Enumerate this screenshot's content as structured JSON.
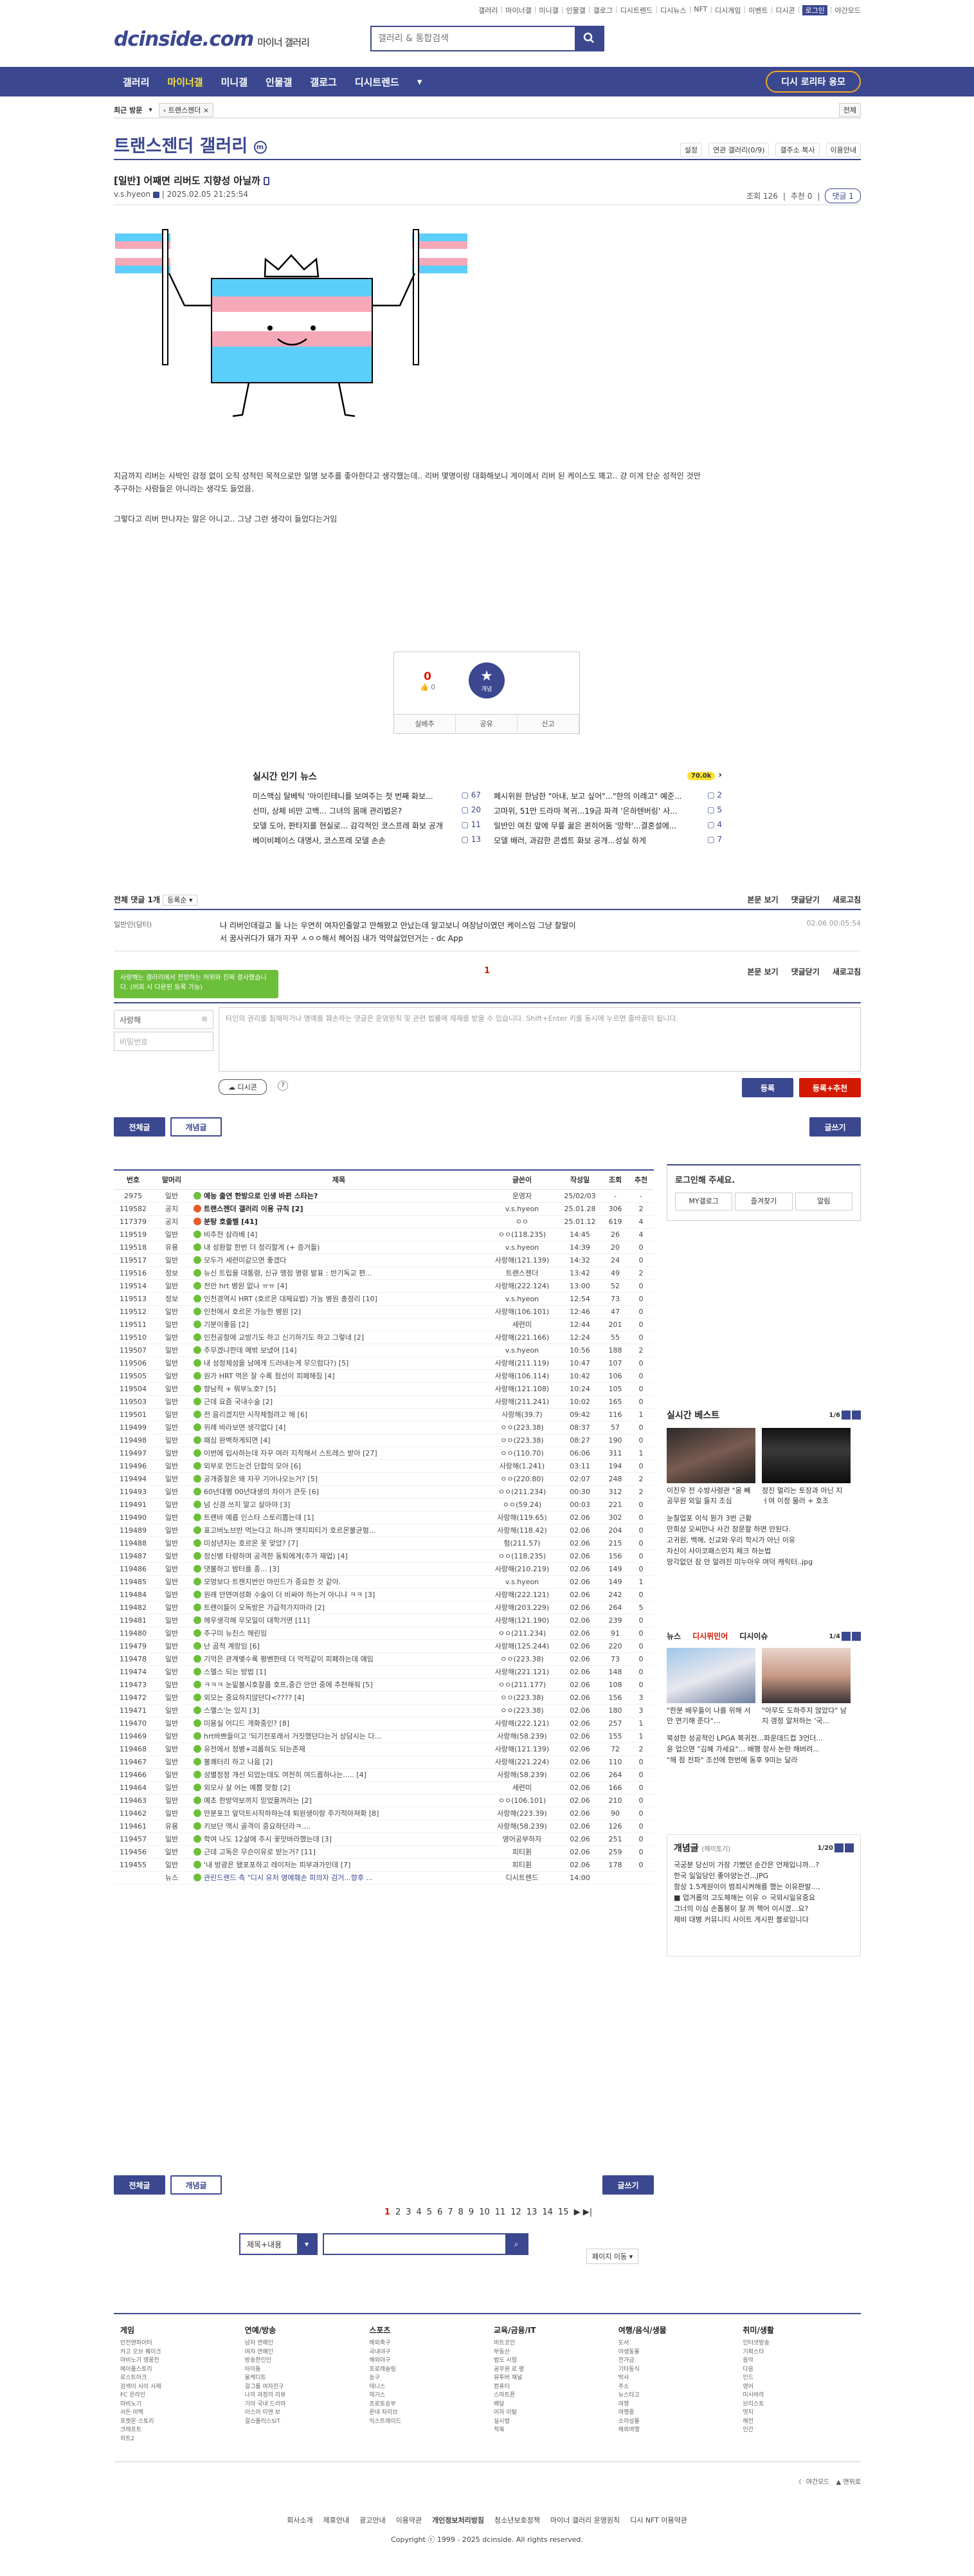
{
  "top_links": [
    "갤러리",
    "마이너갤",
    "미니갤",
    "인물갤",
    "갤로그",
    "디시트렌드",
    "디시뉴스",
    "NFT",
    "디시게임",
    "이벤트",
    "디시콘",
    "로그인",
    "야간모드"
  ],
  "brand": {
    "logo": "dcinside.com",
    "sub": "마이너 갤러리"
  },
  "search": {
    "placeholder": "갤러리 & 통합검색"
  },
  "nav": {
    "items": [
      "갤러리",
      "마이너갤",
      "미니갤",
      "인물갤",
      "갤로그",
      "디시트렌드"
    ],
    "promo": "디시 로리타 응모"
  },
  "crumb": {
    "recent": "최근 방문",
    "gallery": "트랜스젠더",
    "all": "전체"
  },
  "gallery": {
    "title": "트랜스젠더 갤러리",
    "tools": [
      "설정",
      "연관 갤러리(0/9)",
      "갤주소 복사",
      "이용안내"
    ]
  },
  "post": {
    "title": "[일반] 어째면 리버도 지향성 아닐까",
    "author": "v.s.hyeon",
    "date": "2025.02.05 21:25:54",
    "views": "조회 126",
    "recs": "추천 0",
    "comments": "댓글 1",
    "body1": "지금까지 리버는 사박인 감정 없이 오직 성적인 목적으로만 일명 보추를 좋아한다고 생각했는데.. 리버 몇명이랑 대화해보니 게이에서 리버 된 케이스도 꽤고.. 걍 이게 단순 성적인 것만 추구하는 사람들은 아니라는 생각도 들었음.",
    "body2": "그렇다고 리버 만나자는 말은 아니고.. 그냥 그런 생각이 들었다는거임"
  },
  "rec": {
    "up": "0",
    "down": "0",
    "fixed": "개념",
    "actions": [
      "실베추",
      "공유",
      "신고"
    ]
  },
  "news": {
    "title": "실시간 인기 뉴스",
    "badge": "70.0k",
    "items": [
      {
        "t": "미스맥심 탈베틱 '아이린테니를 보여주는 첫 번째 화보...",
        "n": "67"
      },
      {
        "t": "폐시위원 한남한 \"아내, 보고 싶어\"...\"한의 이례고\" 예준...",
        "n": "2"
      },
      {
        "t": "선미, 상체 비만 고백... 그녀의 몸매 관리법은?",
        "n": "20"
      },
      {
        "t": "고마위, 51만 드라마 복귀...19금 파격 '은하텐버링' 사...",
        "n": "5"
      },
      {
        "t": "모델 도아, 판타지를 현실로... 감각적인 코스프레 화보 공개",
        "n": "11"
      },
      {
        "t": "일반인 여친 앞에 무릎 꿇은 퀸히어둠 '망학'...결혼설에...",
        "n": "4"
      },
      {
        "t": "베이비페이스 대명사, 코스프레 모델 손손",
        "n": "13"
      },
      {
        "t": "모델 배러, 과감한 콘셉트 화보 공개...성실 하게",
        "n": "7"
      }
    ]
  },
  "comments": {
    "total": "전체 댓글 1개",
    "sort": "등록순",
    "view": "본문 보기",
    "fold": "댓글닫기",
    "refresh": "새로고침",
    "item": {
      "nick": "일반인(담터)",
      "text": "나 리버인데걸고 둘 나는 우연히 여자인줄알고 만해왔고 만났는데 알고보니 여장남이였던 케이스임 그냥 찰말이서 꿈사귀다가 돼가 자꾸 ㅅㅇㅇ해서 헤어짐 내가 먹약싫었던거는 - dc App",
      "date": "02.06 00:05:54"
    },
    "page": "1",
    "tip": "사랑해는 갤러리에서 전방하는 허위와 진짜 결사했습니다. (비회 시 다운된 등록 가능)",
    "nick_ph": "사랑해",
    "pw_ph": "비밀번호",
    "ta_ph": "타인의 권리를 침해하거나 명예를 훼손하는 댓글은 운영원칙 및 관련 법률에 제재를 받을 수 있습니다. Shift+Enter 키를 동시에 누르면 줄바꿈이 됩니다.",
    "dccon": "디시콘",
    "submit": "등록",
    "submit_rec": "등록+추천"
  },
  "listtabs": {
    "all": "전체글",
    "best": "개념글",
    "write": "글쓰기"
  },
  "table": {
    "headers": [
      "번호",
      "말머리",
      "제목",
      "글쓴이",
      "작성일",
      "조회",
      "추천"
    ],
    "rows": [
      [
        "2975",
        "일반",
        "예능 출연 한방으로 인생 바뀐 스타는?",
        "운영자",
        "25/02/03",
        "-",
        "-"
      ],
      [
        "119582",
        "공지",
        "트랜스젠더 갤러리 이용 규칙 [2]",
        "v.s.hyeon",
        "25.01.28",
        "306",
        "2"
      ],
      [
        "117379",
        "공지",
        "분탕 호출벨 [41]",
        "ㅇㅇ",
        "25.01.12",
        "619",
        "4"
      ],
      [
        "119519",
        "일반",
        "비추천 삼라베 [4]",
        "ㅇㅇ(118.235)",
        "14:45",
        "26",
        "4"
      ],
      [
        "119518",
        "유용",
        "내 성환할 한번 더 정리할게 (+ 증거들)",
        "v.s.hyeon",
        "14:39",
        "20",
        "0"
      ],
      [
        "119517",
        "일반",
        "모두가 세련미같으면 좋겠다",
        "사랑해(121.139)",
        "14:32",
        "24",
        "0"
      ],
      [
        "119516",
        "정보",
        "뉴신 트립을 대통령, 신규 맹점 명령 발표 : 반기독교 편...",
        "트랜스젠더",
        "13:42",
        "49",
        "2"
      ],
      [
        "119514",
        "일반",
        "전안 hrt 병원 없나 ㅠㅠ [4]",
        "사랑해(222.124)",
        "13:00",
        "52",
        "0"
      ],
      [
        "119513",
        "정보",
        "인천경역시 HRT (호르몬 대체요법) 가능 병원 총정리 [10]",
        "v.s.hyeon",
        "12:54",
        "73",
        "0"
      ],
      [
        "119512",
        "일반",
        "인천에서 호르몬 가능한 병원 [2]",
        "사랑해(106.101)",
        "12:46",
        "47",
        "0"
      ],
      [
        "119511",
        "일반",
        "기분이좋음 [2]",
        "세련미",
        "12:44",
        "201",
        "0"
      ],
      [
        "119510",
        "일반",
        "인천공항에 교방기도 하고 신기하기도 하고 그렇네 [2]",
        "사랑해(221.166)",
        "12:24",
        "55",
        "0"
      ],
      [
        "119507",
        "일반",
        "주무겠냐한데 예밖 보냈어 [14]",
        "v.s.hyeon",
        "10:56",
        "188",
        "2"
      ],
      [
        "119506",
        "일반",
        "내 성정체성을 남에게 드러내는게 무으럼다?) [5]",
        "사랑해(211.119)",
        "10:47",
        "107",
        "0"
      ],
      [
        "119505",
        "일반",
        "원가 HRT 먹은 잘 수록 점선이 피페해짐 [4]",
        "사랑해(106.114)",
        "10:42",
        "106",
        "0"
      ],
      [
        "119504",
        "일반",
        "향남적 + 뭐부노호? [5]",
        "사랑해(121.108)",
        "10:24",
        "105",
        "0"
      ],
      [
        "119503",
        "일반",
        "근데 요즘 국내수술 [2]",
        "사랑해(211.241)",
        "10:02",
        "165",
        "0"
      ],
      [
        "119501",
        "일반",
        "전 음리겠지만 시작체험려고 해 [6]",
        "사랑해(39.7)",
        "09:42",
        "116",
        "1"
      ],
      [
        "119499",
        "일반",
        "위례 바라보면 생각없다 [4]",
        "ㅇㅇ(223.38)",
        "08:37",
        "57",
        "0"
      ],
      [
        "119498",
        "일반",
        "패심 완벽하게되면 [4]",
        "ㅇㅇ(223.38)",
        "08:27",
        "190",
        "0"
      ],
      [
        "119497",
        "일반",
        "이번에 입사하는데 자꾸 여러 지적해서 스트레스 받아 [27]",
        "ㅇㅇ(110.70)",
        "06:06",
        "311",
        "1"
      ],
      [
        "119496",
        "일반",
        "외부로 먼드는건 단합의 모아 [6]",
        "사랑해(1.241)",
        "03:11",
        "194",
        "0"
      ],
      [
        "119494",
        "일반",
        "공개중절은 왜 자꾸 기어나오는거? [5]",
        "ㅇㅇ(220.80)",
        "02:07",
        "248",
        "2"
      ],
      [
        "119493",
        "일반",
        "60년대행 00년대생의 차이가 큰듯 [6]",
        "ㅇㅇ(211.234)",
        "00:30",
        "312",
        "2"
      ],
      [
        "119491",
        "일반",
        "넘 신경 쓰지 말고 살아야 [3]",
        "ㅇㅇ(59.24)",
        "00:03",
        "221",
        "0"
      ],
      [
        "119490",
        "일반",
        "트랜바 예릅 인스타 스토리뽑는데 [1]",
        "사랑해(119.65)",
        "02.06",
        "302",
        "0"
      ],
      [
        "119489",
        "일반",
        "표고버노브반 먹는다고 하니까 옛지피티가 호르몬불균형...",
        "사랑해(118.42)",
        "02.06",
        "204",
        "0"
      ],
      [
        "119488",
        "일반",
        "미성년자는 호르몬 못 맞았? [7]",
        "헝(211.57)",
        "02.06",
        "215",
        "0"
      ],
      [
        "119487",
        "일반",
        "정신병 타령하며 공격한 동퇴에게(추가 재업) [4]",
        "ㅇㅇ(118.235)",
        "02.06",
        "156",
        "0"
      ],
      [
        "119486",
        "일반",
        "댓불하고 밤터를 종... [3]",
        "사랑해(210.219)",
        "02.06",
        "149",
        "0"
      ],
      [
        "119485",
        "일반",
        "모멍보다 트젠지번인 마인드가 중요한 것 같아.",
        "v.s.hyeon",
        "02.06",
        "149",
        "1"
      ],
      [
        "119484",
        "일반",
        "원래 안면여성화 수술이 더 비싸야 하는거 아니냐 ㅋㅋ [3]",
        "사랑해(222.121)",
        "02.06",
        "242",
        "0"
      ],
      [
        "119482",
        "일반",
        "트랜이들이 오독방은 가급적가지마라 [2]",
        "사랑해(203.229)",
        "02.06",
        "264",
        "5"
      ],
      [
        "119481",
        "일반",
        "헤우생각해 무모일이 대학거면 [11]",
        "사랑해(121.190)",
        "02.06",
        "239",
        "0"
      ],
      [
        "119480",
        "일반",
        "추구미 뉴진스 해린임",
        "ㅇㅇ(211.234)",
        "02.06",
        "91",
        "0"
      ],
      [
        "119479",
        "일반",
        "난 곰적 계랑임 [6]",
        "사랑해(125.244)",
        "02.06",
        "220",
        "0"
      ],
      [
        "119478",
        "일반",
        "기억은 관계맺수록 평벤한테 더 억적같이 피폐하는데 얘임",
        "ㅇㅇ(223.38)",
        "02.06",
        "73",
        "0"
      ],
      [
        "119474",
        "일반",
        "스멜스 되는 방법 [1]",
        "사랑해(221.121)",
        "02.06",
        "148",
        "0"
      ],
      [
        "119473",
        "일반",
        "ㅋㅋㅋ 눈밑볼시호잘룹 호프,중간 안안 중에 추천해줘 [5]",
        "ㅇㅇ(211.177)",
        "02.06",
        "108",
        "0"
      ],
      [
        "119472",
        "일반",
        "외모는 중요하지않던다<???? [4]",
        "ㅇㅇ(223.38)",
        "02.06",
        "156",
        "3"
      ],
      [
        "119471",
        "일반",
        "스멜스'는 있지 [3]",
        "ㅇㅇ(223.38)",
        "02.06",
        "180",
        "3"
      ],
      [
        "119470",
        "일반",
        "미용실 어디드 개화중인? [8]",
        "사랑해(222.121)",
        "02.06",
        "257",
        "1"
      ],
      [
        "119469",
        "일반",
        "hrt바쁘들이고 '되기전포래서 거짓했던다는거 상담시는 다...",
        "사랑해(58.239)",
        "02.06",
        "155",
        "1"
      ],
      [
        "119468",
        "일반",
        "유전에서 정병+괴롭혀도 되는존재",
        "사랑해(121.139)",
        "02.06",
        "72",
        "2"
      ],
      [
        "119467",
        "일반",
        "불쾌터리 하고 나음 [2]",
        "사랑해(221.224)",
        "02.06",
        "110",
        "0"
      ],
      [
        "119466",
        "일반",
        "성별정정 개선 되었는데도 여전히 여드름하나는..... [4]",
        "사랑해(58.239)",
        "02.06",
        "264",
        "0"
      ],
      [
        "119464",
        "일반",
        "외모사 살 어는 예쁨 맞함 [2]",
        "세련미",
        "02.06",
        "166",
        "0"
      ],
      [
        "119463",
        "일반",
        "예초 한방약보까지 믿었을꺼라는 [2]",
        "ㅇㅇ(106.101)",
        "02.06",
        "210",
        "0"
      ],
      [
        "119462",
        "일반",
        "만분포끄 앞덕트시작하하는데 퇴원생이랑 주기적아져화 [8]",
        "사랑해(223.39)",
        "02.06",
        "90",
        "0"
      ],
      [
        "119461",
        "유용",
        "키보단 액시 골격이 중요하단라ㅋ....",
        "사랑해(58.239)",
        "02.06",
        "126",
        "0"
      ],
      [
        "119457",
        "일반",
        "학여 나도 12살에 추시 꽃맛바라했는데 [3]",
        "영어공부하자",
        "02.06",
        "251",
        "0"
      ],
      [
        "119456",
        "일반",
        "근데 고독은 무슨이유로 받는거? [11]",
        "피티휜",
        "02.06",
        "259",
        "0"
      ],
      [
        "119455",
        "일반",
        "'내 방광은 됐포포하고 레이저는 피부과가인데 [7]",
        "피티휜",
        "02.06",
        "178",
        "0"
      ],
      [
        "",
        "뉴스",
        "관린드랜드 측 \"디시 유저 명예훼손 피의자 검거...향후 ...",
        "디시트렌드",
        "14:00",
        "",
        ""
      ]
    ]
  },
  "side": {
    "login_title": "로그인해 주세요.",
    "login_btns": [
      "MY갤로그",
      "즐겨찾기",
      "알림"
    ],
    "best_title": "실시간 베스트",
    "best_page": "1/6",
    "best_caps": [
      "이진우 전 수방사령관 \"몸 빼 공무원 외일 들지 조심",
      "정진 멀리는 토장과 아닌 지 ㅓ여 이정 물러 + 호조"
    ],
    "best_lines": [
      "눈칠업포 이식 뭔가 3번 근황",
      "만희상 오씨만나 사건 창문할 하면 안된다.",
      "고귀원, 백해, 신교와 우리 학시가 아닌 이유",
      "자신이 사이코패스인지 체크 하는법",
      "망각없던 잠 안 알려진 미누아우 여덕 캐릭터..jpg"
    ],
    "news_tabs": [
      "뉴스",
      "디시위민어",
      "디시이슈"
    ],
    "news_page": "1/4",
    "news_caps": [
      "\"한분 배우들이 나를 위해 서만 연기해 준다\"…",
      "\"아무도 도하주지 않았다\" 남지 갱정 알처하는 '국..."
    ],
    "news_lines": [
      "북성한 성공적인 LPGA 복귀전...파운데드컵 3언더...",
      "윤 업으면 \"김혜 가세요\"... 배행 장사 논란 해버려...",
      "\"해 점 전파\" 조선에 한번에 동후 9미는 달라"
    ],
    "concept_title": "개념글",
    "concept_sub": "(채이토기)",
    "concept_page": "1/20",
    "concept_lines": [
      "국궁분 당신이 가장 기뻤던 순간은 언제입니까...?",
      "한국 일일당인 좋아양는건...JPG",
      "항상 1.5계원이이 범죄시켜해를 했는 이유판발...,",
      "■ 업겨롭의 고도체해는 이유 ㅇ 국외시일유중요",
      "그너의 이심 손톱봉이 잘 꺼 책어 이시겠...요?",
      "제비 대병 커뮤니티 사이트 게시판 블로임니다"
    ]
  },
  "pagination": {
    "pages": [
      "1",
      "2",
      "3",
      "4",
      "5",
      "6",
      "7",
      "8",
      "9",
      "10",
      "11",
      "12",
      "13",
      "14",
      "15"
    ],
    "current": "1"
  },
  "bottom_search": {
    "select": "제목+내용"
  },
  "page_list": "페이지 이동",
  "footer": {
    "cols": [
      {
        "h": "게임",
        "items": [
          "던전앤파이터",
          "카고 오브 퀘이크",
          "마비노기 영웅전",
          "메이플스토리",
          "로스트아크",
          "검색이 사이 사제",
          "FC 온라인",
          "마비노기",
          "서든 어택",
          "포켓몬 스토리",
          "크래프트",
          "히트2"
        ]
      },
      {
        "h": "연예/방송",
        "items": [
          "남자 연예인",
          "여자 연예인",
          "방송한인인",
          "아이돌",
          "올케디트",
          "걸그룹 여자친구",
          "나의 과정의 리뷰",
          "기아 국내 드라마",
          "이스어 이엔 보",
          "걸스플러스SIT"
        ]
      },
      {
        "h": "스포츠",
        "items": [
          "해외축구",
          "국내야구",
          "해외야구",
          "프로레슬링",
          "농구",
          "테니스",
          "레기스",
          "프로토승부",
          "문네 자리브",
          "익스트레이드"
        ]
      },
      {
        "h": "교육/금융/IT",
        "items": [
          "비트코인",
          "부동산",
          "법도 시험",
          "공무원 로 평",
          "유투버 채널",
          "컴퓨터",
          "스마트폰",
          "배달",
          "이자 이탈",
          "실시법",
          "적복"
        ]
      },
      {
        "h": "여행/음식/생물",
        "items": [
          "도서",
          "야생동물",
          "전가금",
          "기타동식",
          "박사",
          "주소",
          "뉴스타고",
          "여행",
          "여행중",
          "소라상물",
          "해외여행"
        ]
      },
      {
        "h": "취미/생활",
        "items": [
          "인터넷방송",
          "기획스타",
          "음악",
          "다음",
          "인드",
          "영어",
          "미시바라",
          "브리스토",
          "멋지",
          "해전",
          "인간"
        ]
      }
    ],
    "bar": [
      "야간모드",
      "맨위로"
    ],
    "links": [
      "회사소개",
      "제휴안내",
      "광고안내",
      "이용약관",
      "개인정보처리방침",
      "청소년보호정책",
      "마이너 갤러리 운영원칙",
      "디시 NFT 이용약관"
    ],
    "copyright": "Copyright ⓒ 1999 - 2025 dcinside. All rights reserved."
  },
  "colors": {
    "brand": "#3b4890",
    "accent": "#d31900",
    "notice_icon": "#e55b2d",
    "post_icon": "#6cbf3b"
  }
}
